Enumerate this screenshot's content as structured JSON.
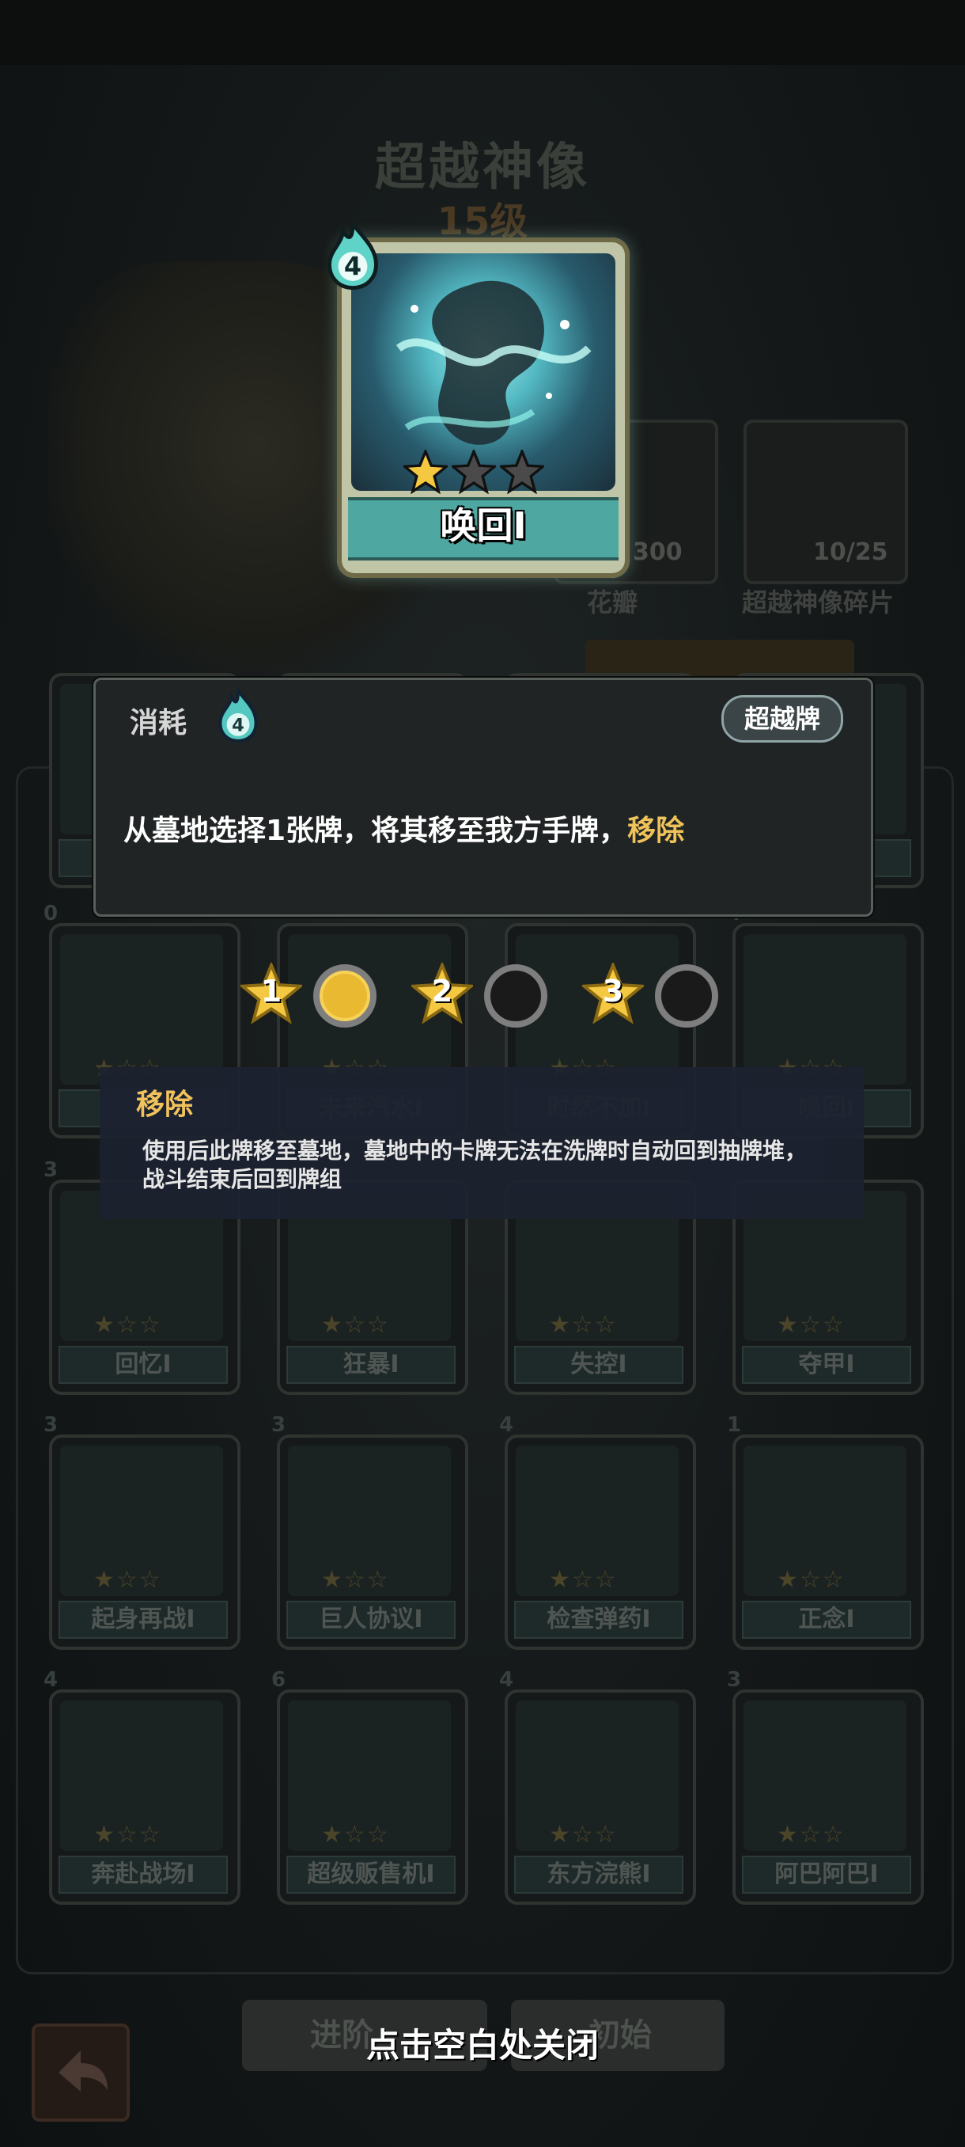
{
  "header": {
    "title": "超越神像",
    "level": "15级"
  },
  "resources": [
    {
      "count": "300",
      "label": "花瓣"
    },
    {
      "count": "10/25",
      "label": "超越神像碎片"
    }
  ],
  "main_card": {
    "name": "唤回I",
    "cost": "4",
    "stars_filled": 1,
    "stars_total": 3
  },
  "info_panel": {
    "consume_label": "消耗",
    "cost": "4",
    "tag": "超越牌",
    "description_prefix": "从墓地选择1张牌，将其移至我方手牌，",
    "description_keyword": "移除"
  },
  "star_levels": [
    {
      "number": "1",
      "active": true
    },
    {
      "number": "2",
      "active": false
    },
    {
      "number": "3",
      "active": false
    }
  ],
  "tooltip": {
    "title": "移除",
    "body_line1": "使用后此牌移至墓地，墓地中的卡牌无法在洗牌时自动回到抽牌堆，",
    "body_line2": "战斗结束后回到牌组"
  },
  "grid_cards": [
    {
      "name": "",
      "cost": ""
    },
    {
      "name": "",
      "cost": ""
    },
    {
      "name": "",
      "cost": ""
    },
    {
      "name": "",
      "cost": ""
    },
    {
      "name": "",
      "cost": "0"
    },
    {
      "name": "未来汽水I",
      "cost": ""
    },
    {
      "name": "时然不加I",
      "cost": ""
    },
    {
      "name": "唤回I",
      "cost": "4"
    },
    {
      "name": "回忆I",
      "cost": "3"
    },
    {
      "name": "狂暴I",
      "cost": ""
    },
    {
      "name": "失控I",
      "cost": ""
    },
    {
      "name": "夺甲I",
      "cost": ""
    },
    {
      "name": "起身再战I",
      "cost": "3"
    },
    {
      "name": "巨人协议I",
      "cost": "3"
    },
    {
      "name": "检查弹药I",
      "cost": "4"
    },
    {
      "name": "正念I",
      "cost": "1"
    },
    {
      "name": "奔赴战场I",
      "cost": "4"
    },
    {
      "name": "超级贩售机I",
      "cost": "6"
    },
    {
      "name": "东方浣熊I",
      "cost": "4"
    },
    {
      "name": "阿巴阿巴I",
      "cost": "3"
    }
  ],
  "bottom": {
    "left_button": "进阶",
    "right_button": "初始",
    "close_hint": "点击空白处关闭"
  },
  "colors": {
    "accent_gold": "#f0c35a",
    "card_teal": "#4fa7a1",
    "panel_bg": "#202424"
  }
}
